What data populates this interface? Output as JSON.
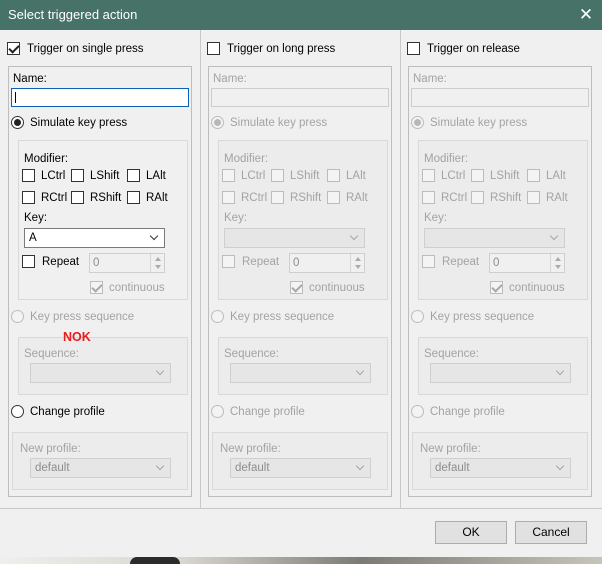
{
  "window": {
    "title": "Select triggered action",
    "close_icon": "close-icon"
  },
  "columns": [
    {
      "trigger_label": "Trigger on single press",
      "trigger_checked": true,
      "name_label": "Name:",
      "name_value": "",
      "simulate_label": "Simulate key press",
      "modifier_label": "Modifier:",
      "modifiers_row1": [
        "LCtrl",
        "LShift",
        "LAlt"
      ],
      "modifiers_row2": [
        "RCtrl",
        "RShift",
        "RAlt"
      ],
      "key_label": "Key:",
      "key_value": "A",
      "repeat_label": "Repeat",
      "repeat_value": "0",
      "continuous_label": "continuous",
      "sequence_radio_label": "Key press sequence",
      "sequence_label": "Sequence:",
      "sequence_value": "",
      "change_profile_label": "Change profile",
      "new_profile_label": "New profile:",
      "new_profile_value": "default"
    },
    {
      "trigger_label": "Trigger on long press",
      "trigger_checked": false,
      "name_label": "Name:",
      "name_value": "",
      "simulate_label": "Simulate key press",
      "modifier_label": "Modifier:",
      "modifiers_row1": [
        "LCtrl",
        "LShift",
        "LAlt"
      ],
      "modifiers_row2": [
        "RCtrl",
        "RShift",
        "RAlt"
      ],
      "key_label": "Key:",
      "key_value": "",
      "repeat_label": "Repeat",
      "repeat_value": "0",
      "continuous_label": "continuous",
      "sequence_radio_label": "Key press sequence",
      "sequence_label": "Sequence:",
      "sequence_value": "",
      "change_profile_label": "Change profile",
      "new_profile_label": "New profile:",
      "new_profile_value": "default"
    },
    {
      "trigger_label": "Trigger on release",
      "trigger_checked": false,
      "name_label": "Name:",
      "name_value": "",
      "simulate_label": "Simulate key press",
      "modifier_label": "Modifier:",
      "modifiers_row1": [
        "LCtrl",
        "LShift",
        "LAlt"
      ],
      "modifiers_row2": [
        "RCtrl",
        "RShift",
        "RAlt"
      ],
      "key_label": "Key:",
      "key_value": "",
      "repeat_label": "Repeat",
      "repeat_value": "0",
      "continuous_label": "continuous",
      "sequence_radio_label": "Key press sequence",
      "sequence_label": "Sequence:",
      "sequence_value": "",
      "change_profile_label": "Change profile",
      "new_profile_label": "New profile:",
      "new_profile_value": "default"
    }
  ],
  "annotation": "NOK",
  "buttons": {
    "ok_label": "OK",
    "cancel_label": "Cancel"
  },
  "colors": {
    "titlebar": "#467268",
    "annotation": "#e81c1c",
    "focus_border": "#0b5fb5"
  }
}
